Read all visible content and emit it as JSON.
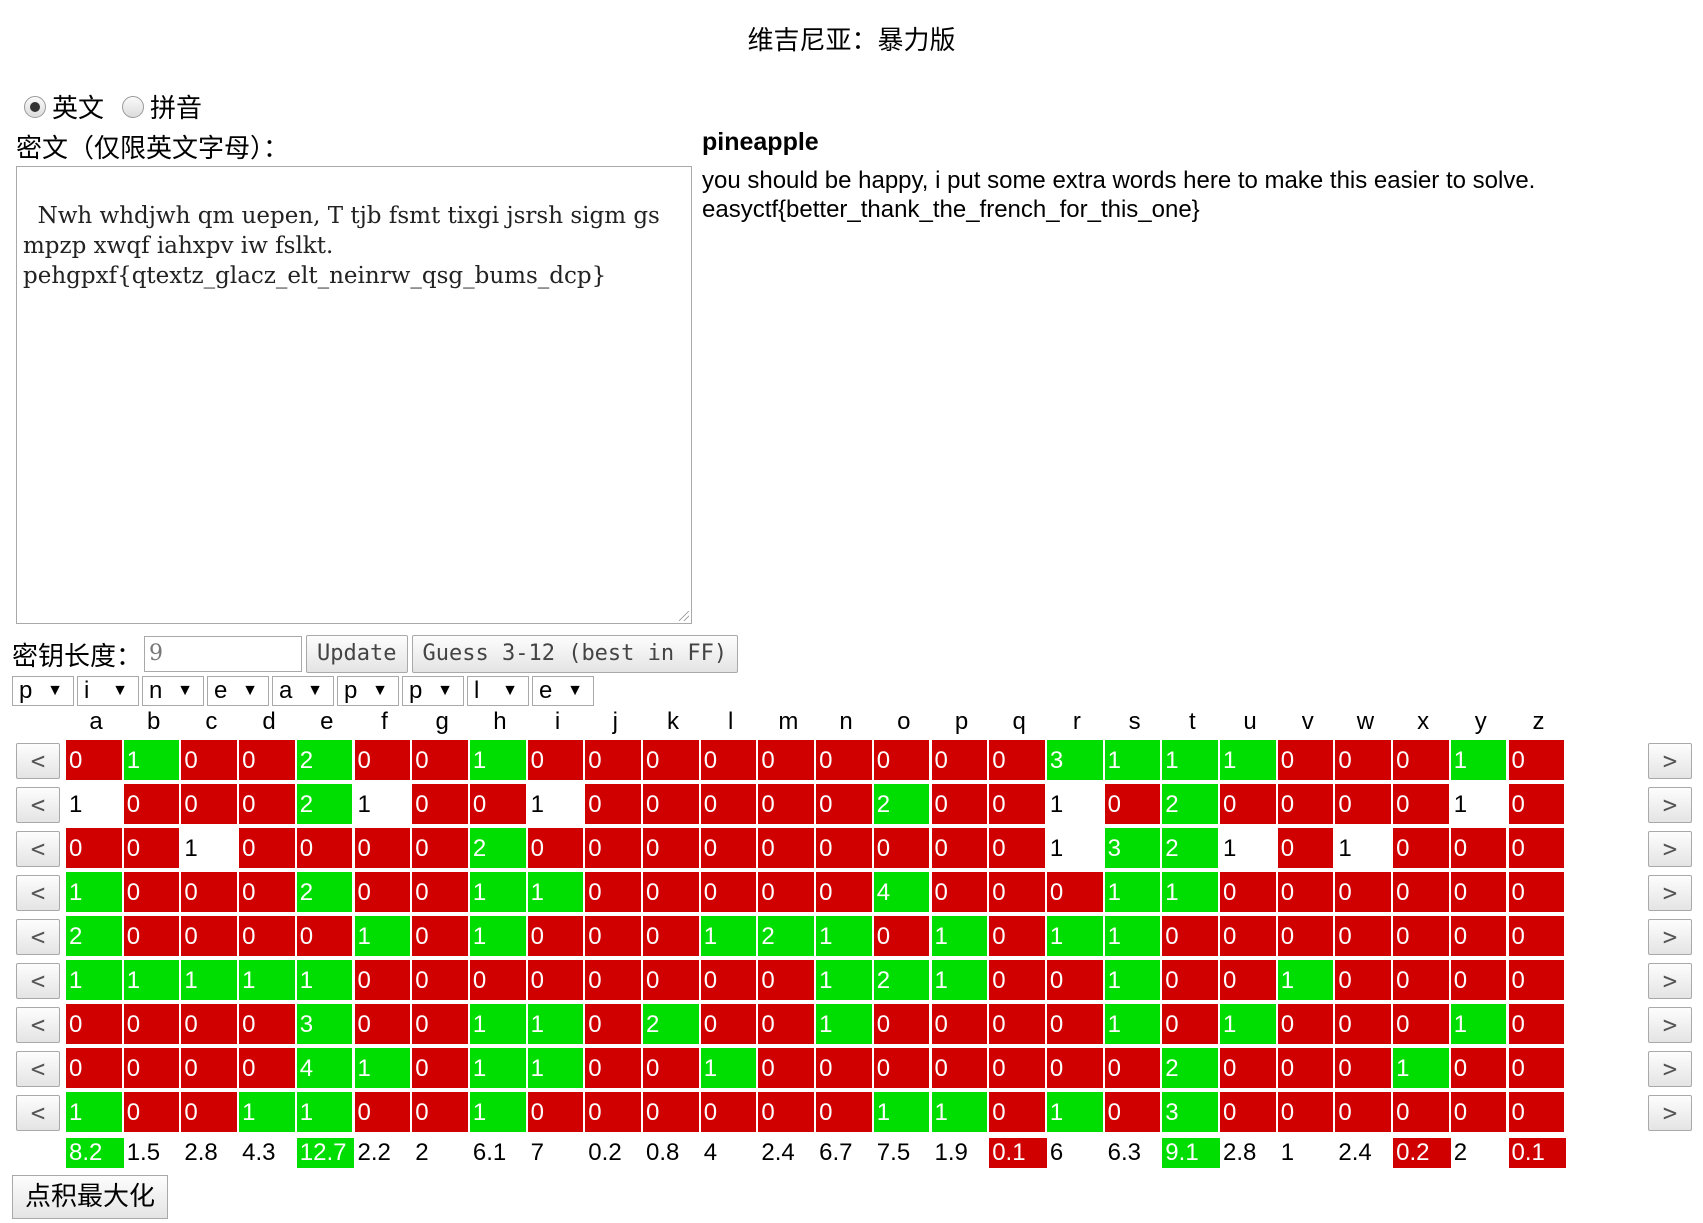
{
  "title": "维吉尼亚：暴力版",
  "language_options": [
    {
      "label": "英文",
      "checked": true
    },
    {
      "label": "拼音",
      "checked": false
    }
  ],
  "cipher_label": "密文（仅限英文字母）：",
  "ciphertext": "Nwh whdjwh qm uepen, T tjb fsmt tixgi jsrsh sigm gs mpzp xwqf iahxpv iw fslkt.\npehgpxf{qtextz_glacz_elt_neinrw_qsg_bums_dcp}",
  "key_word": "pineapple",
  "plaintext": "you should be happy, i put some extra words here to make this easier to solve.\neasyctf{better_thank_the_french_for_this_one}",
  "key_length_label": "密钥长度：",
  "key_length_value": "9",
  "update_button": "Update",
  "guess_button": "Guess 3-12 (best in FF)",
  "key_selects": [
    "p",
    "i",
    "n",
    "e",
    "a",
    "p",
    "p",
    "l",
    "e"
  ],
  "select_arrow": "▼",
  "nav_prev": "<",
  "nav_next": ">",
  "alphabet": [
    "a",
    "b",
    "c",
    "d",
    "e",
    "f",
    "g",
    "h",
    "i",
    "j",
    "k",
    "l",
    "m",
    "n",
    "o",
    "p",
    "q",
    "r",
    "s",
    "t",
    "u",
    "v",
    "w",
    "x",
    "y",
    "z"
  ],
  "grid": [
    {
      "values": [
        0,
        1,
        0,
        0,
        2,
        0,
        0,
        1,
        0,
        0,
        0,
        0,
        0,
        0,
        0,
        0,
        0,
        3,
        1,
        1,
        1,
        0,
        0,
        0,
        1,
        0
      ],
      "colors": [
        "r",
        "g",
        "r",
        "r",
        "g",
        "r",
        "r",
        "g",
        "r",
        "r",
        "r",
        "r",
        "r",
        "r",
        "r",
        "r",
        "r",
        "g",
        "g",
        "g",
        "g",
        "r",
        "r",
        "r",
        "g",
        "r"
      ]
    },
    {
      "values": [
        1,
        0,
        0,
        0,
        2,
        1,
        0,
        0,
        1,
        0,
        0,
        0,
        0,
        0,
        2,
        0,
        0,
        1,
        0,
        2,
        0,
        0,
        0,
        0,
        1,
        0
      ],
      "colors": [
        "w",
        "r",
        "r",
        "r",
        "g",
        "w",
        "r",
        "r",
        "w",
        "r",
        "r",
        "r",
        "r",
        "r",
        "g",
        "r",
        "r",
        "w",
        "r",
        "g",
        "r",
        "r",
        "r",
        "r",
        "w",
        "r"
      ]
    },
    {
      "values": [
        0,
        0,
        1,
        0,
        0,
        0,
        0,
        2,
        0,
        0,
        0,
        0,
        0,
        0,
        0,
        0,
        0,
        1,
        3,
        2,
        1,
        0,
        1,
        0,
        0,
        0
      ],
      "colors": [
        "r",
        "r",
        "w",
        "r",
        "r",
        "r",
        "r",
        "g",
        "r",
        "r",
        "r",
        "r",
        "r",
        "r",
        "r",
        "r",
        "r",
        "w",
        "g",
        "g",
        "w",
        "r",
        "w",
        "r",
        "r",
        "r"
      ]
    },
    {
      "values": [
        1,
        0,
        0,
        0,
        2,
        0,
        0,
        1,
        1,
        0,
        0,
        0,
        0,
        0,
        4,
        0,
        0,
        0,
        1,
        1,
        0,
        0,
        0,
        0,
        0,
        0
      ],
      "colors": [
        "g",
        "r",
        "r",
        "r",
        "g",
        "r",
        "r",
        "g",
        "g",
        "r",
        "r",
        "r",
        "r",
        "r",
        "g",
        "r",
        "r",
        "r",
        "g",
        "g",
        "r",
        "r",
        "r",
        "r",
        "r",
        "r"
      ]
    },
    {
      "values": [
        2,
        0,
        0,
        0,
        0,
        1,
        0,
        1,
        0,
        0,
        0,
        1,
        2,
        1,
        0,
        1,
        0,
        1,
        1,
        0,
        0,
        0,
        0,
        0,
        0,
        0
      ],
      "colors": [
        "g",
        "r",
        "r",
        "r",
        "r",
        "g",
        "r",
        "g",
        "r",
        "r",
        "r",
        "g",
        "g",
        "g",
        "r",
        "g",
        "r",
        "g",
        "g",
        "r",
        "r",
        "r",
        "r",
        "r",
        "r",
        "r"
      ]
    },
    {
      "values": [
        1,
        1,
        1,
        1,
        1,
        0,
        0,
        0,
        0,
        0,
        0,
        0,
        0,
        1,
        2,
        1,
        0,
        0,
        1,
        0,
        0,
        1,
        0,
        0,
        0,
        0
      ],
      "colors": [
        "g",
        "g",
        "g",
        "g",
        "g",
        "r",
        "r",
        "r",
        "r",
        "r",
        "r",
        "r",
        "r",
        "g",
        "g",
        "g",
        "r",
        "r",
        "g",
        "r",
        "r",
        "g",
        "r",
        "r",
        "r",
        "r"
      ]
    },
    {
      "values": [
        0,
        0,
        0,
        0,
        3,
        0,
        0,
        1,
        1,
        0,
        2,
        0,
        0,
        1,
        0,
        0,
        0,
        0,
        1,
        0,
        1,
        0,
        0,
        0,
        1,
        0
      ],
      "colors": [
        "r",
        "r",
        "r",
        "r",
        "g",
        "r",
        "r",
        "g",
        "g",
        "r",
        "g",
        "r",
        "r",
        "g",
        "r",
        "r",
        "r",
        "r",
        "g",
        "r",
        "g",
        "r",
        "r",
        "r",
        "g",
        "r"
      ]
    },
    {
      "values": [
        0,
        0,
        0,
        0,
        4,
        1,
        0,
        1,
        1,
        0,
        0,
        1,
        0,
        0,
        0,
        0,
        0,
        0,
        0,
        2,
        0,
        0,
        0,
        1,
        0,
        0
      ],
      "colors": [
        "r",
        "r",
        "r",
        "r",
        "g",
        "g",
        "r",
        "g",
        "g",
        "r",
        "r",
        "g",
        "r",
        "r",
        "r",
        "r",
        "r",
        "r",
        "r",
        "g",
        "r",
        "r",
        "r",
        "g",
        "r",
        "r"
      ]
    },
    {
      "values": [
        1,
        0,
        0,
        1,
        1,
        0,
        0,
        1,
        0,
        0,
        0,
        0,
        0,
        0,
        1,
        1,
        0,
        1,
        0,
        3,
        0,
        0,
        0,
        0,
        0,
        0
      ],
      "colors": [
        "g",
        "r",
        "r",
        "g",
        "g",
        "r",
        "r",
        "g",
        "r",
        "r",
        "r",
        "r",
        "r",
        "r",
        "g",
        "g",
        "r",
        "g",
        "r",
        "g",
        "r",
        "r",
        "r",
        "r",
        "r",
        "r"
      ]
    }
  ],
  "frequencies": {
    "values": [
      "8.2",
      "1.5",
      "2.8",
      "4.3",
      "12.7",
      "2.2",
      "2",
      "6.1",
      "7",
      "0.2",
      "0.8",
      "4",
      "2.4",
      "6.7",
      "7.5",
      "1.9",
      "0.1",
      "6",
      "6.3",
      "9.1",
      "2.8",
      "1",
      "2.4",
      "0.2",
      "2",
      "0.1"
    ],
    "colors": [
      "g",
      "w",
      "w",
      "w",
      "g",
      "w",
      "w",
      "w",
      "w",
      "w",
      "w",
      "w",
      "w",
      "w",
      "w",
      "w",
      "r",
      "w",
      "w",
      "g",
      "w",
      "w",
      "w",
      "r",
      "w",
      "r"
    ]
  },
  "maximize_button": "点积最大化",
  "colors": {
    "red": "#d10000",
    "green": "#00dd00"
  }
}
